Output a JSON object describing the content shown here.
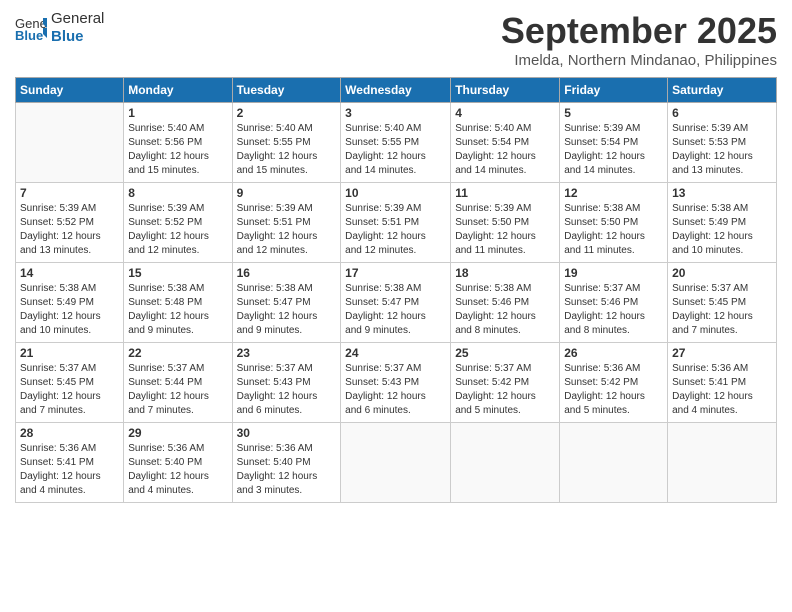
{
  "logo": {
    "general": "General",
    "blue": "Blue"
  },
  "title": "September 2025",
  "location": "Imelda, Northern Mindanao, Philippines",
  "headers": [
    "Sunday",
    "Monday",
    "Tuesday",
    "Wednesday",
    "Thursday",
    "Friday",
    "Saturday"
  ],
  "weeks": [
    [
      {
        "day": "",
        "info": ""
      },
      {
        "day": "1",
        "info": "Sunrise: 5:40 AM\nSunset: 5:56 PM\nDaylight: 12 hours\nand 15 minutes."
      },
      {
        "day": "2",
        "info": "Sunrise: 5:40 AM\nSunset: 5:55 PM\nDaylight: 12 hours\nand 15 minutes."
      },
      {
        "day": "3",
        "info": "Sunrise: 5:40 AM\nSunset: 5:55 PM\nDaylight: 12 hours\nand 14 minutes."
      },
      {
        "day": "4",
        "info": "Sunrise: 5:40 AM\nSunset: 5:54 PM\nDaylight: 12 hours\nand 14 minutes."
      },
      {
        "day": "5",
        "info": "Sunrise: 5:39 AM\nSunset: 5:54 PM\nDaylight: 12 hours\nand 14 minutes."
      },
      {
        "day": "6",
        "info": "Sunrise: 5:39 AM\nSunset: 5:53 PM\nDaylight: 12 hours\nand 13 minutes."
      }
    ],
    [
      {
        "day": "7",
        "info": "Sunrise: 5:39 AM\nSunset: 5:52 PM\nDaylight: 12 hours\nand 13 minutes."
      },
      {
        "day": "8",
        "info": "Sunrise: 5:39 AM\nSunset: 5:52 PM\nDaylight: 12 hours\nand 12 minutes."
      },
      {
        "day": "9",
        "info": "Sunrise: 5:39 AM\nSunset: 5:51 PM\nDaylight: 12 hours\nand 12 minutes."
      },
      {
        "day": "10",
        "info": "Sunrise: 5:39 AM\nSunset: 5:51 PM\nDaylight: 12 hours\nand 12 minutes."
      },
      {
        "day": "11",
        "info": "Sunrise: 5:39 AM\nSunset: 5:50 PM\nDaylight: 12 hours\nand 11 minutes."
      },
      {
        "day": "12",
        "info": "Sunrise: 5:38 AM\nSunset: 5:50 PM\nDaylight: 12 hours\nand 11 minutes."
      },
      {
        "day": "13",
        "info": "Sunrise: 5:38 AM\nSunset: 5:49 PM\nDaylight: 12 hours\nand 10 minutes."
      }
    ],
    [
      {
        "day": "14",
        "info": "Sunrise: 5:38 AM\nSunset: 5:49 PM\nDaylight: 12 hours\nand 10 minutes."
      },
      {
        "day": "15",
        "info": "Sunrise: 5:38 AM\nSunset: 5:48 PM\nDaylight: 12 hours\nand 9 minutes."
      },
      {
        "day": "16",
        "info": "Sunrise: 5:38 AM\nSunset: 5:47 PM\nDaylight: 12 hours\nand 9 minutes."
      },
      {
        "day": "17",
        "info": "Sunrise: 5:38 AM\nSunset: 5:47 PM\nDaylight: 12 hours\nand 9 minutes."
      },
      {
        "day": "18",
        "info": "Sunrise: 5:38 AM\nSunset: 5:46 PM\nDaylight: 12 hours\nand 8 minutes."
      },
      {
        "day": "19",
        "info": "Sunrise: 5:37 AM\nSunset: 5:46 PM\nDaylight: 12 hours\nand 8 minutes."
      },
      {
        "day": "20",
        "info": "Sunrise: 5:37 AM\nSunset: 5:45 PM\nDaylight: 12 hours\nand 7 minutes."
      }
    ],
    [
      {
        "day": "21",
        "info": "Sunrise: 5:37 AM\nSunset: 5:45 PM\nDaylight: 12 hours\nand 7 minutes."
      },
      {
        "day": "22",
        "info": "Sunrise: 5:37 AM\nSunset: 5:44 PM\nDaylight: 12 hours\nand 7 minutes."
      },
      {
        "day": "23",
        "info": "Sunrise: 5:37 AM\nSunset: 5:43 PM\nDaylight: 12 hours\nand 6 minutes."
      },
      {
        "day": "24",
        "info": "Sunrise: 5:37 AM\nSunset: 5:43 PM\nDaylight: 12 hours\nand 6 minutes."
      },
      {
        "day": "25",
        "info": "Sunrise: 5:37 AM\nSunset: 5:42 PM\nDaylight: 12 hours\nand 5 minutes."
      },
      {
        "day": "26",
        "info": "Sunrise: 5:36 AM\nSunset: 5:42 PM\nDaylight: 12 hours\nand 5 minutes."
      },
      {
        "day": "27",
        "info": "Sunrise: 5:36 AM\nSunset: 5:41 PM\nDaylight: 12 hours\nand 4 minutes."
      }
    ],
    [
      {
        "day": "28",
        "info": "Sunrise: 5:36 AM\nSunset: 5:41 PM\nDaylight: 12 hours\nand 4 minutes."
      },
      {
        "day": "29",
        "info": "Sunrise: 5:36 AM\nSunset: 5:40 PM\nDaylight: 12 hours\nand 4 minutes."
      },
      {
        "day": "30",
        "info": "Sunrise: 5:36 AM\nSunset: 5:40 PM\nDaylight: 12 hours\nand 3 minutes."
      },
      {
        "day": "",
        "info": ""
      },
      {
        "day": "",
        "info": ""
      },
      {
        "day": "",
        "info": ""
      },
      {
        "day": "",
        "info": ""
      }
    ]
  ]
}
